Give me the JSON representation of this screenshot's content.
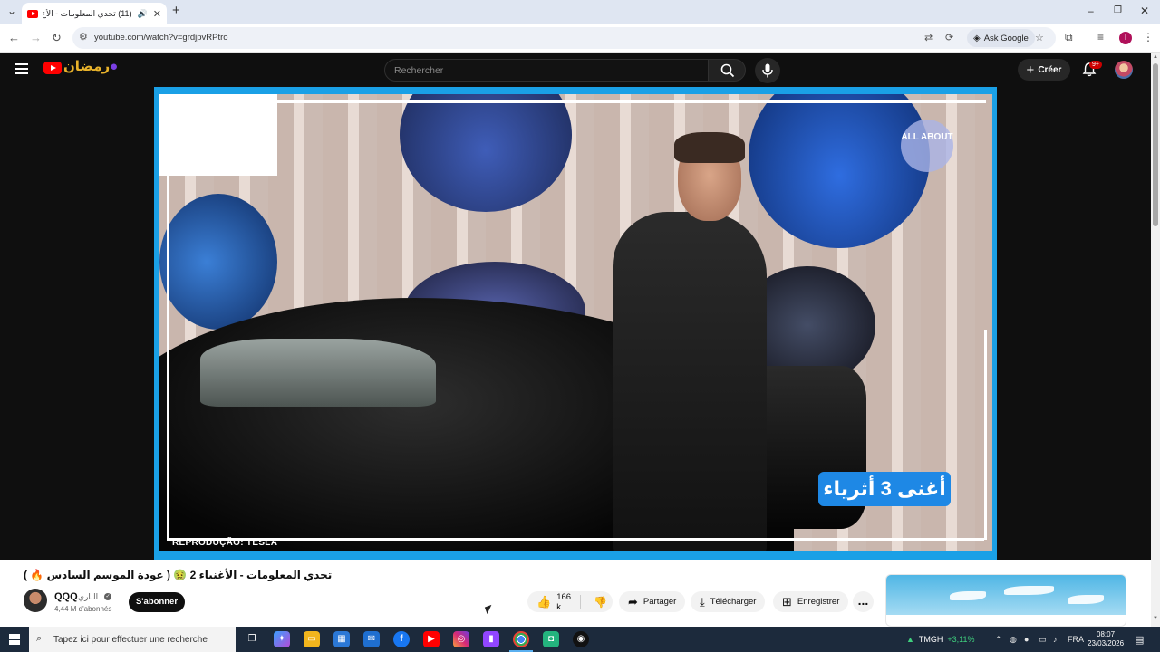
{
  "browser": {
    "tab_title": "(11) تحدي المعلومات - الأغ...",
    "url": "youtube.com/watch?v=grdjpvRPtro",
    "ask_google": "Ask Google",
    "profile_initial": "I"
  },
  "youtube": {
    "search_placeholder": "Rechercher",
    "create_label": "Créer",
    "notifications_badge": "9+",
    "video": {
      "overlay_caption": "أغنى 3 أثرياء",
      "watermark_text": "ALL ABOUT",
      "credit": "REPRODUÇÃO: TESLA",
      "title": "تحدي المعلومات - الأغنياء 2 🤢 ( عودة الموسم السادس 🔥 )"
    },
    "channel": {
      "name": "QQQ",
      "name_ar": "الناري",
      "subscribers": "4,44 M d'abonnés",
      "subscribe_label": "S'abonner"
    },
    "actions": {
      "likes": "166 k",
      "share": "Partager",
      "download": "Télécharger",
      "save": "Enregistrer",
      "more": "..."
    }
  },
  "taskbar": {
    "search_placeholder": "Tapez ici pour effectuer une recherche",
    "stock_symbol": "TMGH",
    "stock_change": "+3,11%",
    "language": "FRA",
    "time": "08:07",
    "date": "23/03/2026"
  }
}
